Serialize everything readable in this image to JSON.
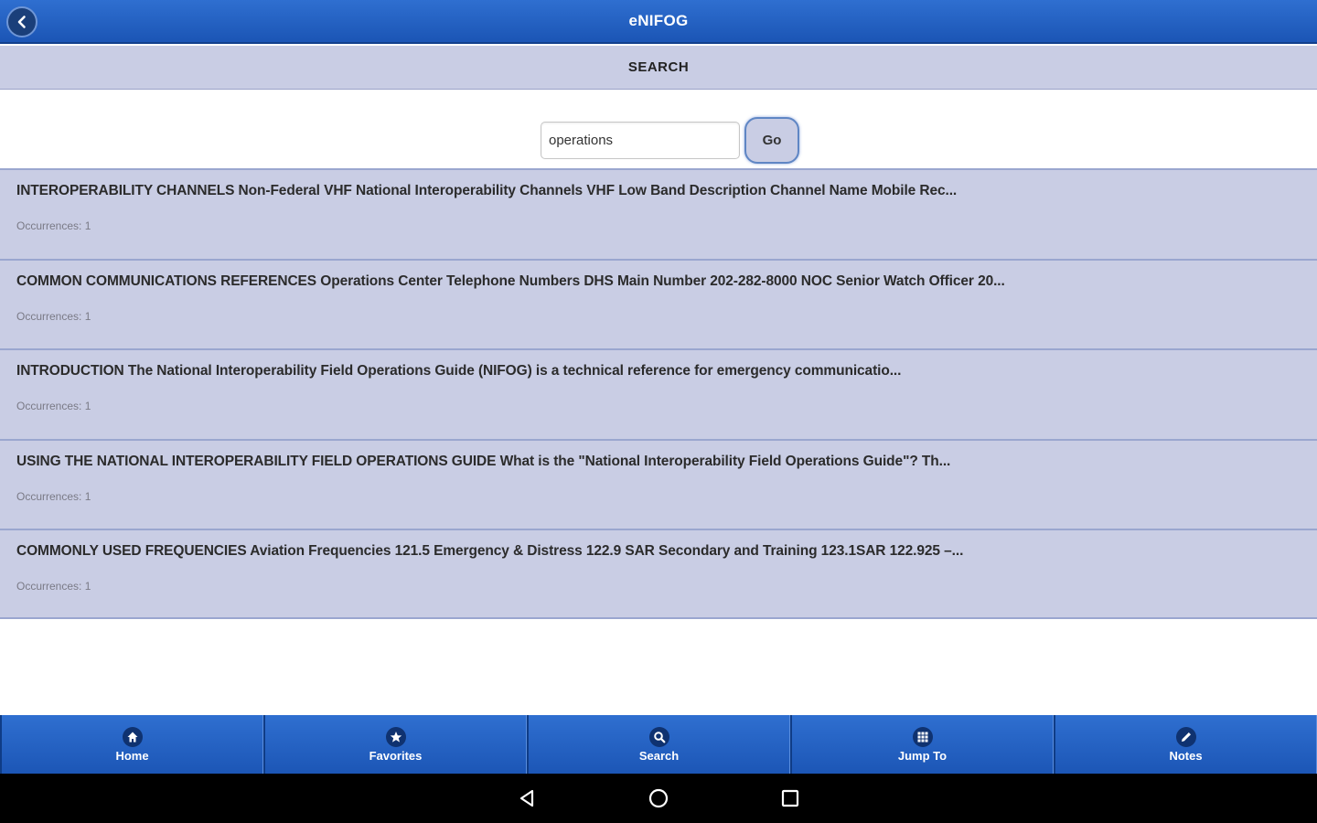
{
  "header": {
    "title": "eNIFOG"
  },
  "subheader": {
    "label": "SEARCH"
  },
  "search": {
    "value": "operations",
    "go_label": "Go"
  },
  "results": [
    {
      "title": "INTEROPERABILITY CHANNELS Non-Federal VHF National Interoperability Channels VHF Low Band Description Channel Name Mobile Rec...",
      "occurrences": "Occurrences: 1"
    },
    {
      "title": "COMMON COMMUNICATIONS REFERENCES Operations Center Telephone Numbers DHS Main Number 202-282-8000 NOC Senior Watch Officer 20...",
      "occurrences": "Occurrences: 1"
    },
    {
      "title": "INTRODUCTION The National Interoperability Field Operations Guide (NIFOG) is a technical reference for emergency communicatio...",
      "occurrences": "Occurrences: 1"
    },
    {
      "title": "USING THE NATIONAL INTEROPERABILITY FIELD OPERATIONS GUIDE What is the \"National Interoperability Field Operations Guide\"? Th...",
      "occurrences": "Occurrences: 1"
    },
    {
      "title": "COMMONLY USED FREQUENCIES Aviation Frequencies 121.5 Emergency & Distress 122.9 SAR Secondary and Training 123.1SAR 122.925 –...",
      "occurrences": "Occurrences: 1"
    }
  ],
  "tabs": [
    {
      "label": "Home",
      "icon": "home-icon"
    },
    {
      "label": "Favorites",
      "icon": "star-icon"
    },
    {
      "label": "Search",
      "icon": "search-icon"
    },
    {
      "label": "Jump To",
      "icon": "grid-icon"
    },
    {
      "label": "Notes",
      "icon": "pencil-icon"
    }
  ],
  "colors": {
    "header": "#2f6fd0",
    "row": "#c9cde4",
    "nav": "#000000"
  }
}
